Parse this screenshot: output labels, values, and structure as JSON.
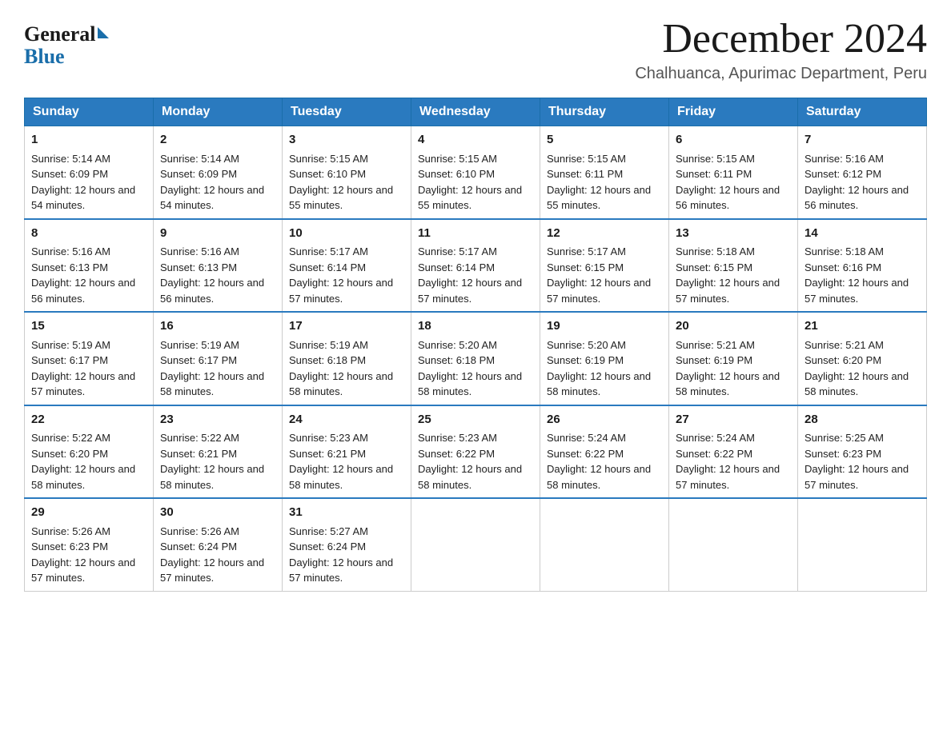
{
  "logo": {
    "general": "General",
    "blue": "Blue"
  },
  "header": {
    "month_title": "December 2024",
    "location": "Chalhuanca, Apurimac Department, Peru"
  },
  "days_of_week": [
    "Sunday",
    "Monday",
    "Tuesday",
    "Wednesday",
    "Thursday",
    "Friday",
    "Saturday"
  ],
  "weeks": [
    [
      {
        "day": "1",
        "sunrise": "5:14 AM",
        "sunset": "6:09 PM",
        "daylight": "12 hours and 54 minutes."
      },
      {
        "day": "2",
        "sunrise": "5:14 AM",
        "sunset": "6:09 PM",
        "daylight": "12 hours and 54 minutes."
      },
      {
        "day": "3",
        "sunrise": "5:15 AM",
        "sunset": "6:10 PM",
        "daylight": "12 hours and 55 minutes."
      },
      {
        "day": "4",
        "sunrise": "5:15 AM",
        "sunset": "6:10 PM",
        "daylight": "12 hours and 55 minutes."
      },
      {
        "day": "5",
        "sunrise": "5:15 AM",
        "sunset": "6:11 PM",
        "daylight": "12 hours and 55 minutes."
      },
      {
        "day": "6",
        "sunrise": "5:15 AM",
        "sunset": "6:11 PM",
        "daylight": "12 hours and 56 minutes."
      },
      {
        "day": "7",
        "sunrise": "5:16 AM",
        "sunset": "6:12 PM",
        "daylight": "12 hours and 56 minutes."
      }
    ],
    [
      {
        "day": "8",
        "sunrise": "5:16 AM",
        "sunset": "6:13 PM",
        "daylight": "12 hours and 56 minutes."
      },
      {
        "day": "9",
        "sunrise": "5:16 AM",
        "sunset": "6:13 PM",
        "daylight": "12 hours and 56 minutes."
      },
      {
        "day": "10",
        "sunrise": "5:17 AM",
        "sunset": "6:14 PM",
        "daylight": "12 hours and 57 minutes."
      },
      {
        "day": "11",
        "sunrise": "5:17 AM",
        "sunset": "6:14 PM",
        "daylight": "12 hours and 57 minutes."
      },
      {
        "day": "12",
        "sunrise": "5:17 AM",
        "sunset": "6:15 PM",
        "daylight": "12 hours and 57 minutes."
      },
      {
        "day": "13",
        "sunrise": "5:18 AM",
        "sunset": "6:15 PM",
        "daylight": "12 hours and 57 minutes."
      },
      {
        "day": "14",
        "sunrise": "5:18 AM",
        "sunset": "6:16 PM",
        "daylight": "12 hours and 57 minutes."
      }
    ],
    [
      {
        "day": "15",
        "sunrise": "5:19 AM",
        "sunset": "6:17 PM",
        "daylight": "12 hours and 57 minutes."
      },
      {
        "day": "16",
        "sunrise": "5:19 AM",
        "sunset": "6:17 PM",
        "daylight": "12 hours and 58 minutes."
      },
      {
        "day": "17",
        "sunrise": "5:19 AM",
        "sunset": "6:18 PM",
        "daylight": "12 hours and 58 minutes."
      },
      {
        "day": "18",
        "sunrise": "5:20 AM",
        "sunset": "6:18 PM",
        "daylight": "12 hours and 58 minutes."
      },
      {
        "day": "19",
        "sunrise": "5:20 AM",
        "sunset": "6:19 PM",
        "daylight": "12 hours and 58 minutes."
      },
      {
        "day": "20",
        "sunrise": "5:21 AM",
        "sunset": "6:19 PM",
        "daylight": "12 hours and 58 minutes."
      },
      {
        "day": "21",
        "sunrise": "5:21 AM",
        "sunset": "6:20 PM",
        "daylight": "12 hours and 58 minutes."
      }
    ],
    [
      {
        "day": "22",
        "sunrise": "5:22 AM",
        "sunset": "6:20 PM",
        "daylight": "12 hours and 58 minutes."
      },
      {
        "day": "23",
        "sunrise": "5:22 AM",
        "sunset": "6:21 PM",
        "daylight": "12 hours and 58 minutes."
      },
      {
        "day": "24",
        "sunrise": "5:23 AM",
        "sunset": "6:21 PM",
        "daylight": "12 hours and 58 minutes."
      },
      {
        "day": "25",
        "sunrise": "5:23 AM",
        "sunset": "6:22 PM",
        "daylight": "12 hours and 58 minutes."
      },
      {
        "day": "26",
        "sunrise": "5:24 AM",
        "sunset": "6:22 PM",
        "daylight": "12 hours and 58 minutes."
      },
      {
        "day": "27",
        "sunrise": "5:24 AM",
        "sunset": "6:22 PM",
        "daylight": "12 hours and 57 minutes."
      },
      {
        "day": "28",
        "sunrise": "5:25 AM",
        "sunset": "6:23 PM",
        "daylight": "12 hours and 57 minutes."
      }
    ],
    [
      {
        "day": "29",
        "sunrise": "5:26 AM",
        "sunset": "6:23 PM",
        "daylight": "12 hours and 57 minutes."
      },
      {
        "day": "30",
        "sunrise": "5:26 AM",
        "sunset": "6:24 PM",
        "daylight": "12 hours and 57 minutes."
      },
      {
        "day": "31",
        "sunrise": "5:27 AM",
        "sunset": "6:24 PM",
        "daylight": "12 hours and 57 minutes."
      },
      null,
      null,
      null,
      null
    ]
  ]
}
